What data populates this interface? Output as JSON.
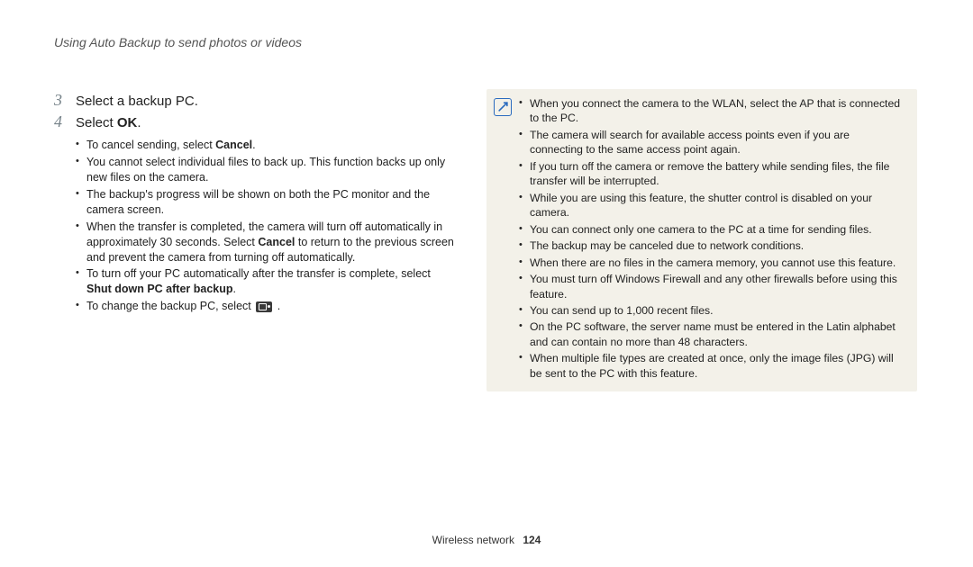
{
  "header": "Using Auto Backup to send photos or videos",
  "steps": [
    {
      "num": "3",
      "label": "Select a backup PC."
    },
    {
      "num": "4",
      "label_pre": "Select ",
      "label_bold": "OK",
      "label_post": "."
    }
  ],
  "sub_bullets": {
    "b0_pre": "To cancel sending, select ",
    "b0_bold": "Cancel",
    "b0_post": ".",
    "b1": "You cannot select individual files to back up. This function backs up only new files on the camera.",
    "b2": "The backup's progress will be shown on both the PC monitor and the camera screen.",
    "b3_pre": "When the transfer is completed, the camera will turn off automatically in approximately 30 seconds. Select ",
    "b3_bold": "Cancel",
    "b3_post": " to return to the previous screen and prevent the camera from turning off automatically.",
    "b4_pre": "To turn off your PC automatically after the transfer is complete, select ",
    "b4_bold": "Shut down PC after backup",
    "b4_post": ".",
    "b5_pre": "To change the backup PC, select ",
    "b5_post": " ."
  },
  "notes": {
    "n0": "When you connect the camera to the WLAN, select the AP that is connected to the PC.",
    "n1": "The camera will search for available access points even if you are connecting to the same access point again.",
    "n2": "If you turn off the camera or remove the battery while sending files, the file transfer will be interrupted.",
    "n3": "While you are using this feature, the shutter control is disabled on your camera.",
    "n4": "You can connect only one camera to the PC at a time for sending files.",
    "n5": "The backup may be canceled due to network conditions.",
    "n6": "When there are no files in the camera memory, you cannot use this feature.",
    "n7": "You must turn off Windows Firewall and any other firewalls before using this feature.",
    "n8": "You can send up to 1,000 recent files.",
    "n9": "On the PC software, the server name must be entered in the Latin alphabet and can contain no more than 48 characters.",
    "n10": "When multiple file types are created at once, only the image files (JPG) will be sent to the PC with this feature."
  },
  "footer": {
    "section": "Wireless network",
    "page": "124"
  }
}
